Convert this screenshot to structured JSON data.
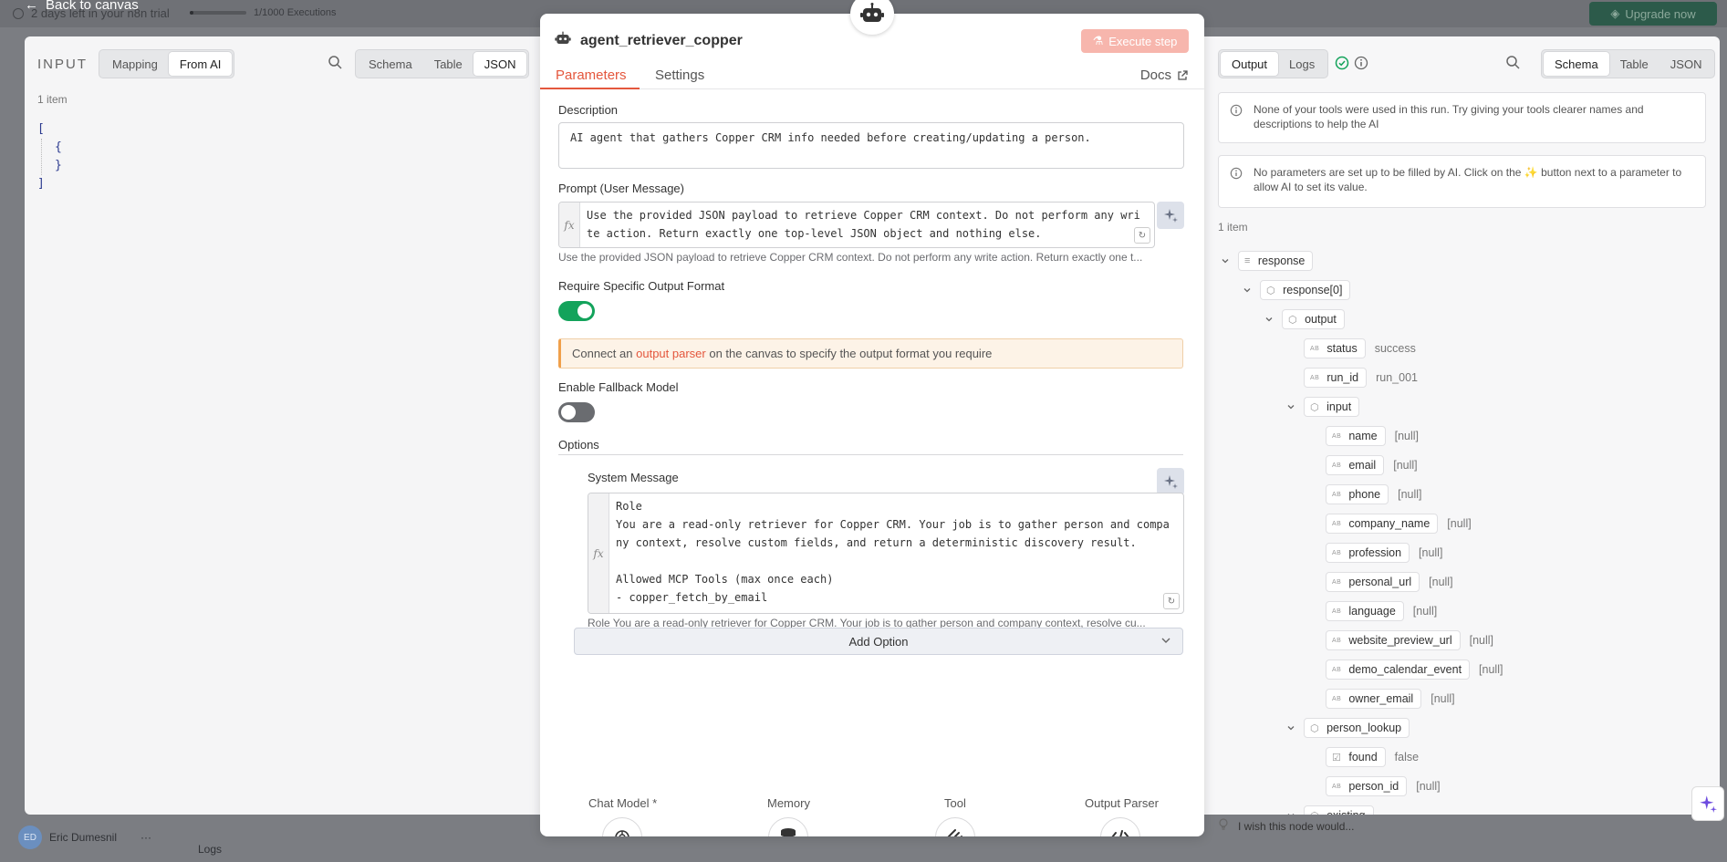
{
  "backdrop": {
    "trial_text": "2 days left in your n8n trial",
    "executions_text": "1/1000 Executions",
    "executions_progress": 0.001,
    "upgrade_label": "Upgrade now",
    "back_label": "Back to canvas",
    "user_initials": "ED",
    "user_name": "Eric Dumesnil",
    "more_label": "···",
    "logs_label": "Logs"
  },
  "left": {
    "title": "INPUT",
    "mode_tabs": [
      "Mapping",
      "From AI"
    ],
    "view_tabs": [
      "Schema",
      "Table",
      "JSON"
    ],
    "item_count": "1 item",
    "json_lines": [
      "[",
      "{",
      "}",
      "]"
    ]
  },
  "node": {
    "name": "agent_retriever_copper",
    "execute_label": "Execute step",
    "tabs": [
      "Parameters",
      "Settings"
    ],
    "docs_label": "Docs",
    "description_label": "Description",
    "description_value": "AI agent that gathers Copper CRM info needed before creating/updating a person.",
    "prompt_label": "Prompt (User Message)",
    "prompt_value": "Use the provided JSON payload to retrieve Copper CRM context. Do not perform any write action. Return exactly one top-level JSON object and nothing else.",
    "prompt_hint": "Use the provided JSON payload to retrieve Copper CRM context. Do not perform any write action. Return exactly one t...",
    "require_format_label": "Require Specific Output Format",
    "require_format_on": true,
    "notice_pre": "Connect an",
    "notice_link": "output parser",
    "notice_post": "on the canvas to specify the output format you require",
    "fallback_label": "Enable Fallback Model",
    "fallback_on": false,
    "options_label": "Options",
    "system_message_label": "System Message",
    "system_message_value": "Role\nYou are a read-only retriever for Copper CRM. Your job is to gather person and company context, resolve custom fields, and return a deterministic discovery result.\n\nAllowed MCP Tools (max once each)\n- copper_fetch_by_email",
    "system_message_hint": "Role You are a read-only retriever for Copper CRM. Your job is to gather person and company context, resolve cu...",
    "add_option_label": "Add Option",
    "subnodes": [
      "Chat Model *",
      "Memory",
      "Tool",
      "Output Parser"
    ]
  },
  "right": {
    "tabs": [
      "Output",
      "Logs"
    ],
    "view_tabs": [
      "Schema",
      "Table",
      "JSON"
    ],
    "note1": "None of your tools were used in this run. Try giving your tools clearer names and descriptions to help the AI",
    "note2": "No parameters are set up to be filled by AI. Click on the ✨ button next to a parameter to allow AI to set its value.",
    "item_count": "1 item",
    "tree": [
      {
        "depth": 0,
        "chev": true,
        "type": "list",
        "key": "response",
        "value": ""
      },
      {
        "depth": 1,
        "chev": true,
        "type": "obj",
        "key": "response[0]",
        "value": ""
      },
      {
        "depth": 2,
        "chev": true,
        "type": "obj",
        "key": "output",
        "value": ""
      },
      {
        "depth": 3,
        "chev": false,
        "type": "str",
        "key": "status",
        "value": "success"
      },
      {
        "depth": 3,
        "chev": false,
        "type": "str",
        "key": "run_id",
        "value": "run_001"
      },
      {
        "depth": 3,
        "chev": true,
        "type": "obj",
        "key": "input",
        "value": ""
      },
      {
        "depth": 4,
        "chev": false,
        "type": "str",
        "key": "name",
        "value": "[null]"
      },
      {
        "depth": 4,
        "chev": false,
        "type": "str",
        "key": "email",
        "value": "[null]"
      },
      {
        "depth": 4,
        "chev": false,
        "type": "str",
        "key": "phone",
        "value": "[null]"
      },
      {
        "depth": 4,
        "chev": false,
        "type": "str",
        "key": "company_name",
        "value": "[null]"
      },
      {
        "depth": 4,
        "chev": false,
        "type": "str",
        "key": "profession",
        "value": "[null]"
      },
      {
        "depth": 4,
        "chev": false,
        "type": "str",
        "key": "personal_url",
        "value": "[null]"
      },
      {
        "depth": 4,
        "chev": false,
        "type": "str",
        "key": "language",
        "value": "[null]"
      },
      {
        "depth": 4,
        "chev": false,
        "type": "str",
        "key": "website_preview_url",
        "value": "[null]"
      },
      {
        "depth": 4,
        "chev": false,
        "type": "str",
        "key": "demo_calendar_event",
        "value": "[null]"
      },
      {
        "depth": 4,
        "chev": false,
        "type": "str",
        "key": "owner_email",
        "value": "[null]"
      },
      {
        "depth": 3,
        "chev": true,
        "type": "obj",
        "key": "person_lookup",
        "value": ""
      },
      {
        "depth": 4,
        "chev": false,
        "type": "bool",
        "key": "found",
        "value": "false"
      },
      {
        "depth": 4,
        "chev": false,
        "type": "str",
        "key": "person_id",
        "value": "[null]"
      },
      {
        "depth": 3,
        "chev": true,
        "type": "obj",
        "key": "existing",
        "value": ""
      }
    ],
    "wish_label": "I wish this node would..."
  },
  "colors": {
    "accent": "#e4573d",
    "success": "#13a35b",
    "link": "#e4573d"
  }
}
